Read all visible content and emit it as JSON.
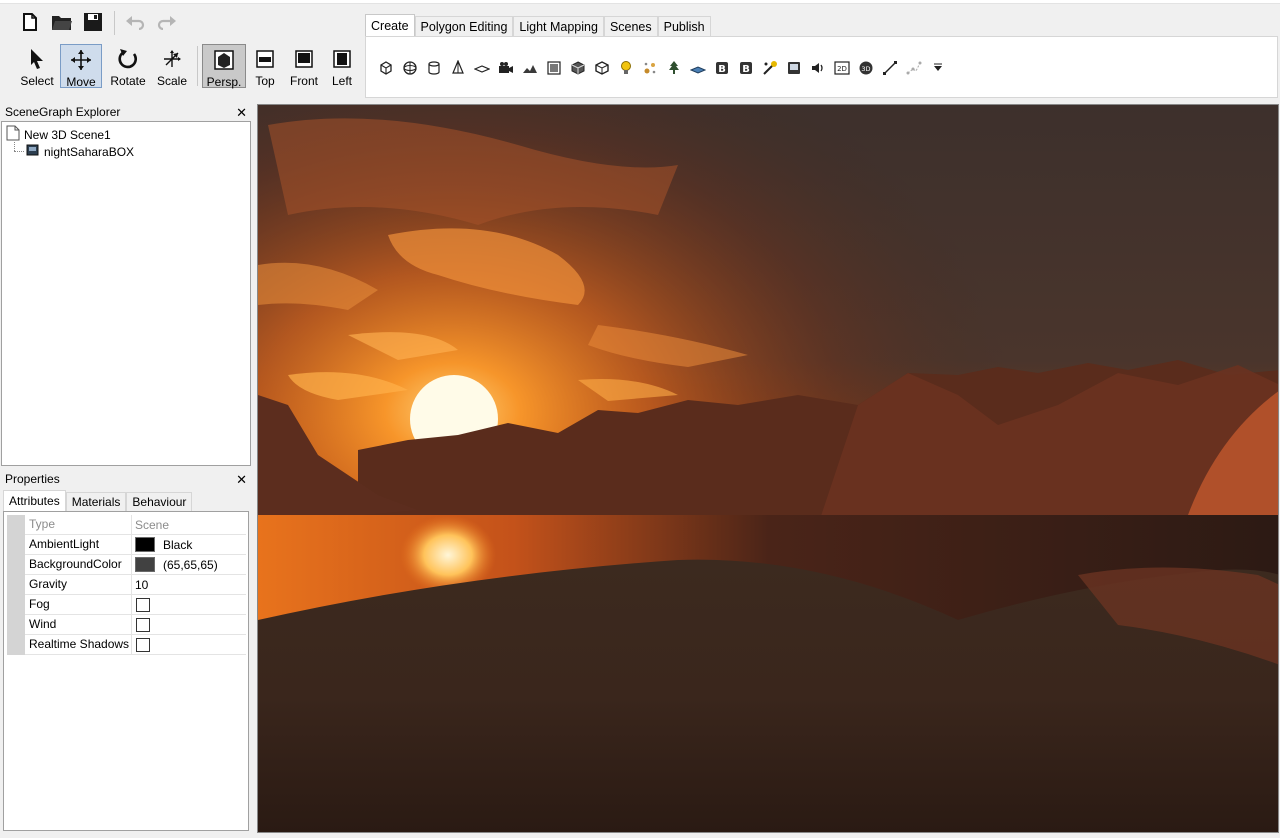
{
  "toolbar": {
    "file_icons": [
      "new-file-icon",
      "open-folder-icon",
      "save-icon",
      "undo-icon",
      "redo-icon"
    ],
    "tools": [
      {
        "label": "Select",
        "icon": "cursor-icon"
      },
      {
        "label": "Move",
        "icon": "move-arrows-icon",
        "state": "active"
      },
      {
        "label": "Rotate",
        "icon": "rotate-icon"
      },
      {
        "label": "Scale",
        "icon": "scale-icon"
      },
      {
        "label": "Persp.",
        "icon": "perspective-view-icon",
        "state": "pressed"
      },
      {
        "label": "Top",
        "icon": "top-view-icon"
      },
      {
        "label": "Front",
        "icon": "front-view-icon"
      },
      {
        "label": "Left",
        "icon": "left-view-icon"
      }
    ]
  },
  "ribbon": {
    "tabs": [
      "Create",
      "Polygon Editing",
      "Light Mapping",
      "Scenes",
      "Publish"
    ],
    "selected_tab": "Create",
    "create_icons": [
      "cube-icon",
      "sphere-icon",
      "cylinder-icon",
      "cone-icon",
      "plane-icon",
      "camera-icon",
      "terrain-icon",
      "billboard-icon",
      "mesh-icon",
      "skybox-icon",
      "light-bulb-icon",
      "particle-system-icon",
      "tree-icon",
      "water-surface-icon",
      "behavior-b-icon",
      "behavior-b2-icon",
      "path-animation-icon",
      "mobile-icon",
      "sound-icon",
      "2d-overlay-icon",
      "3d-sound-icon",
      "line-icon",
      "path-nodes-icon",
      "more-dropdown-icon"
    ]
  },
  "explorer": {
    "title": "SceneGraph Explorer",
    "root": "New 3D Scene1",
    "child": "nightSaharaBOX"
  },
  "properties": {
    "title": "Properties",
    "tabs": [
      "Attributes",
      "Materials",
      "Behaviour"
    ],
    "selected_tab": "Attributes",
    "rows": {
      "type": {
        "name": "Type",
        "value": "Scene"
      },
      "ambient": {
        "name": "AmbientLight",
        "value": "Black",
        "color": "#000000"
      },
      "background": {
        "name": "BackgroundColor",
        "value": "(65,65,65)",
        "color": "#414141"
      },
      "gravity": {
        "name": "Gravity",
        "value": "10"
      },
      "fog": {
        "name": "Fog",
        "checked": false
      },
      "wind": {
        "name": "Wind",
        "checked": false
      },
      "shadows": {
        "name": "Realtime Shadows",
        "checked": false
      }
    }
  },
  "viewport": {
    "content": "3d-scene-sunset-skybox"
  }
}
